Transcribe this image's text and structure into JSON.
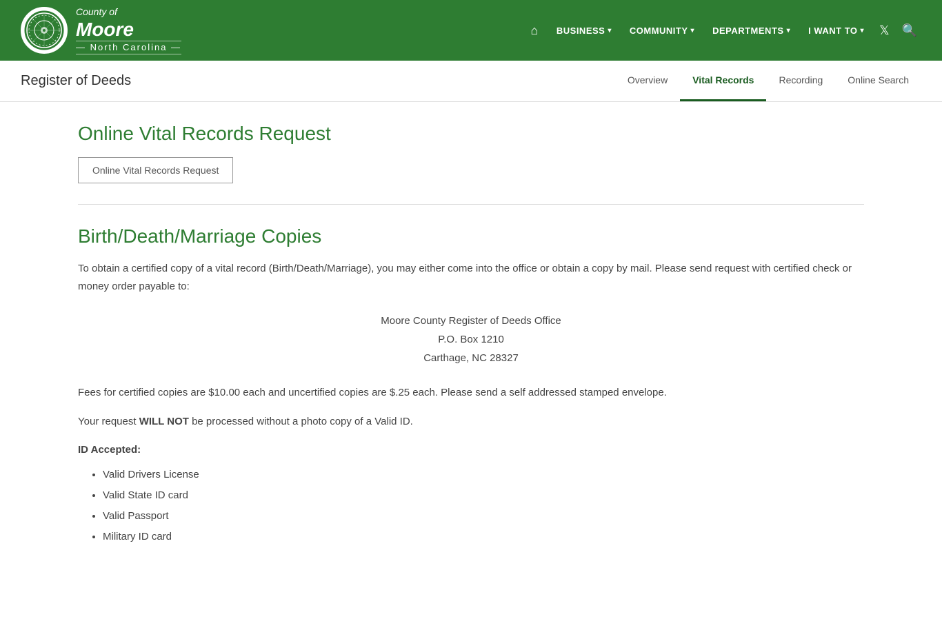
{
  "header": {
    "logo": {
      "county_of": "County of",
      "county_name": "Moore",
      "state_name": "— North Carolina —"
    },
    "nav": {
      "home_label": "",
      "business_label": "BUSINESS",
      "community_label": "COMMUNITY",
      "departments_label": "DEPARTMENTS",
      "iwantto_label": "I WANT TO"
    }
  },
  "subheader": {
    "page_title": "Register of Deeds",
    "tabs": [
      {
        "label": "Overview",
        "active": false
      },
      {
        "label": "Vital Records",
        "active": true
      },
      {
        "label": "Recording",
        "active": false
      },
      {
        "label": "Online Search",
        "active": false
      }
    ]
  },
  "main": {
    "section1": {
      "title": "Online Vital Records Request",
      "button_label": "Online Vital Records Request"
    },
    "section2": {
      "title": "Birth/Death/Marriage Copies",
      "body_text": "To obtain a certified copy of a vital record (Birth/Death/Marriage), you may either come into the office or obtain a copy by mail. Please send request with certified check or money order payable to:",
      "address_line1": "Moore County Register of Deeds Office",
      "address_line2": "P.O. Box 1210",
      "address_line3": "Carthage, NC 28327",
      "fees_text": "Fees for certified copies are $10.00 each and uncertified copies are $.25 each. Please send a self addressed stamped envelope.",
      "request_text_pre": "Your request ",
      "request_text_bold": "WILL NOT",
      "request_text_post": " be processed without a photo copy of a Valid ID.",
      "id_accepted_label": "ID Accepted:",
      "id_list": [
        "Valid Drivers License",
        "Valid State ID card",
        "Valid Passport",
        "Military ID card"
      ]
    }
  }
}
